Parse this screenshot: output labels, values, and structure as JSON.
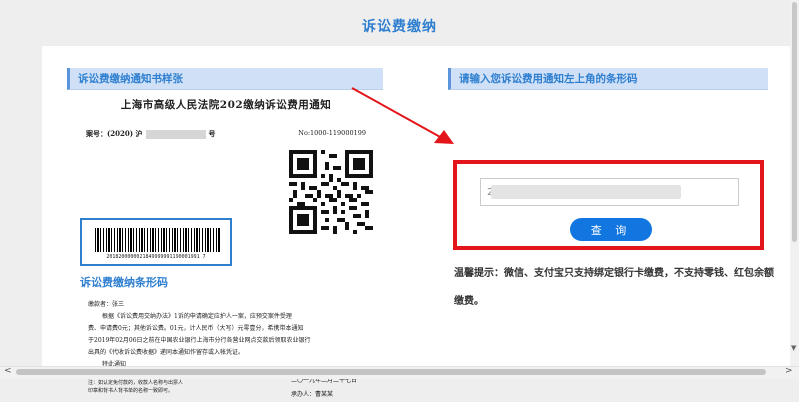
{
  "page": {
    "title": "诉讼费缴纳"
  },
  "left_panel": {
    "header": "诉讼费缴纳通知书样张",
    "notice": {
      "title": "上海市高级人民法院202缴纳诉讼费用通知",
      "case_no_prefix": "案号：(2020) 沪",
      "case_no_suffix": "号",
      "no_label": "No:1000-119000199",
      "barcode_digits": "2018200000021849999991190001991 7",
      "barcode_caption": "诉讼费缴纳条形码",
      "body_lines": [
        "缴款者：张三",
        "根据《诉讼费用交纳办法》1诉的申请确定应护人一案，应预交案件受理",
        "费、申请费0元；其他诉讼费。01元，计人民币（大写）元零壹分，希携带本通知",
        "于2019年02月06日之前在中国农业银行上海市分行各营业网点交款后领取农业银行",
        "出具的《代收诉讼费收据》递同本通知作留存或入帐凭证。",
        "特此通知"
      ],
      "footer_left": "注：如认定免付款的，收款人名称与出票人\n印章和背书人背书单的名称一致即可。",
      "date": "二〇一九年二月二十七日",
      "handler": "承办人：曹某某"
    }
  },
  "right_panel": {
    "header": "请输入您诉讼费用通知左上角的条形码",
    "input_value": "20",
    "query_button": "查 询",
    "tip": "温馨提示：微信、支付宝只支持绑定银行卡缴费，不支持零钱、红包余额缴费。"
  },
  "colors": {
    "accent": "#2f7fd0",
    "highlight": "#e3151b",
    "button": "#1276e0"
  },
  "icons": [
    "red-arrow-icon",
    "qr-code-icon",
    "barcode-icon",
    "scroll-left-icon",
    "scroll-right-icon"
  ]
}
